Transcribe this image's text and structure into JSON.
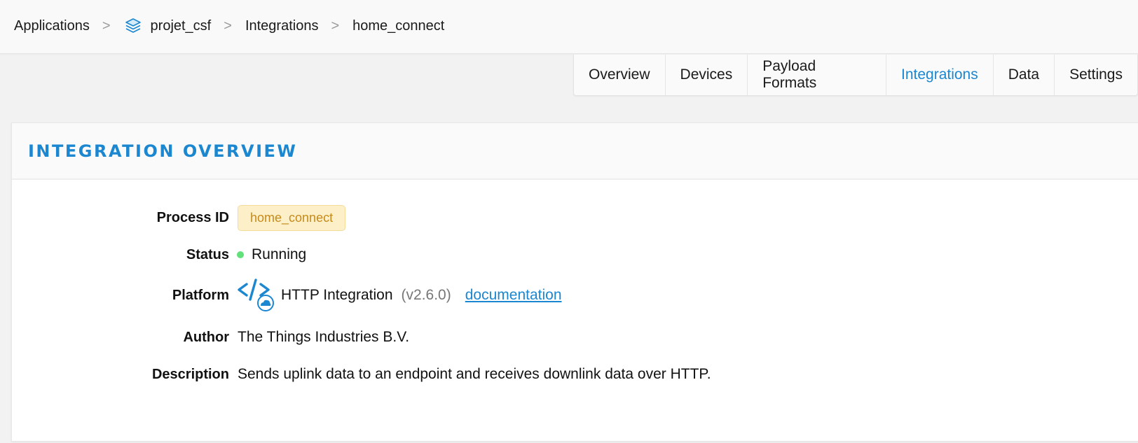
{
  "breadcrumb": {
    "items": [
      "Applications",
      "projet_csf",
      "Integrations",
      "home_connect"
    ],
    "separator": ">"
  },
  "tabs": [
    {
      "label": "Overview"
    },
    {
      "label": "Devices"
    },
    {
      "label": "Payload Formats"
    },
    {
      "label": "Integrations",
      "active": true
    },
    {
      "label": "Data"
    },
    {
      "label": "Settings"
    }
  ],
  "card": {
    "title": "Integration Overview"
  },
  "fields": {
    "process_id_label": "Process ID",
    "process_id": "home_connect",
    "status_label": "Status",
    "status": "Running",
    "platform_label": "Platform",
    "platform_name": "HTTP Integration",
    "platform_version": "(v2.6.0)",
    "documentation": "documentation",
    "author_label": "Author",
    "author": "The Things Industries B.V.",
    "description_label": "Description",
    "description": "Sends uplink data to an endpoint and receives downlink data over HTTP."
  },
  "colors": {
    "accent": "#1b87d1",
    "status_running": "#62e07a",
    "badge_bg": "#fdf0c9",
    "badge_text": "#c58a1a"
  },
  "icons": {
    "app": "layers-icon",
    "platform": "http-integration-icon"
  }
}
